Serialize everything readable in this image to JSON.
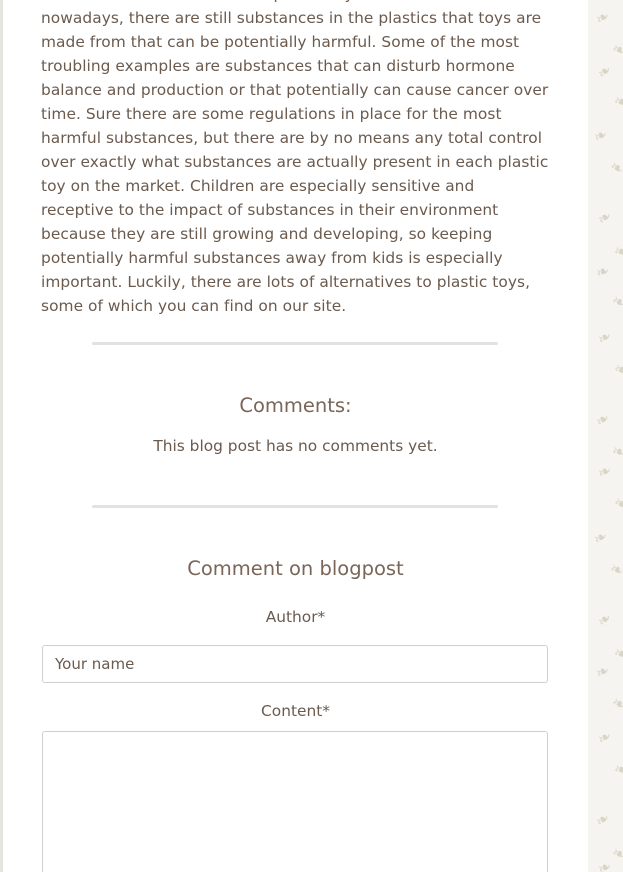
{
  "article": {
    "text": "substances that were used in plastic toys earlier are forbidden nowadays, there are still substances in the plastics that toys are made from that can be potentially harmful. Some of the most troubling examples are substances that can disturb hormone balance and production or that potentially can cause cancer over time. Sure there are some regulations in place for the most harmful substances, but there are by no means any total control over exactly what substances are actually present in each plastic toy on the market. Children are especially sensitive and receptive to the impact of substances in their environment because they are still growing and developing, so keeping potentially harmful substances away from kids is especially important. Luckily, there are lots of alternatives to plastic toys, some of which you can find on our site."
  },
  "comments": {
    "title": "Comments:",
    "empty_message": "This blog post has no comments yet."
  },
  "comment_form": {
    "title": "Comment on blogpost",
    "author_label": "Author*",
    "author_placeholder": "Your name",
    "author_value": "",
    "content_label": "Content*",
    "content_value": ""
  },
  "decoration": {
    "icon": "leaf-icon",
    "color": "#d9d6c8"
  },
  "colors": {
    "text": "#6b5a4e",
    "heading": "#7a6559",
    "divider": "#e2e2e2",
    "background": "#f4f3ef"
  }
}
